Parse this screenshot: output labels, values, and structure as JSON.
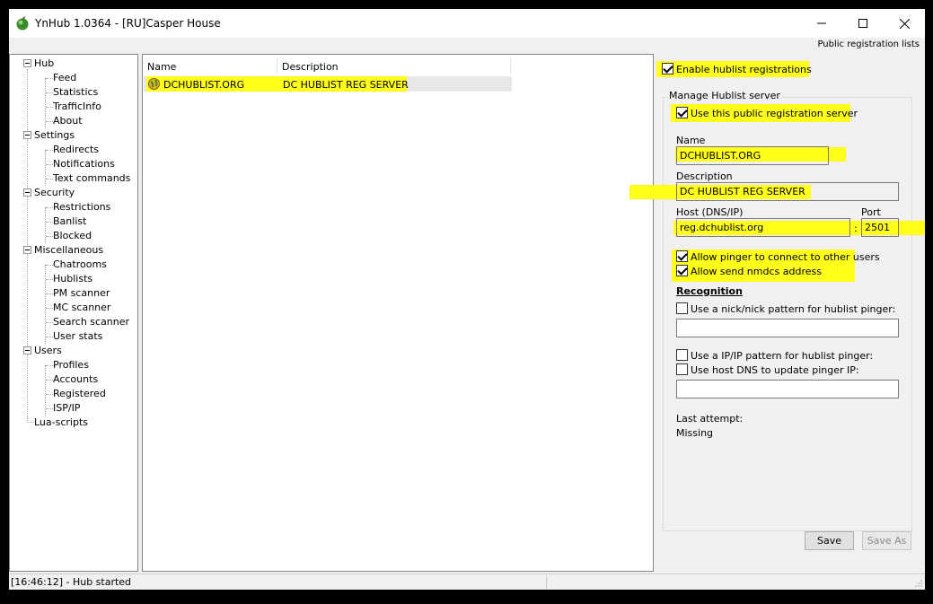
{
  "window": {
    "title": "YnHub 1.0364 - [RU]Casper House",
    "page_label": "Public registration lists"
  },
  "tree": {
    "hub": "Hub",
    "feed": "Feed",
    "statistics": "Statistics",
    "trafficinfo": "TrafficInfo",
    "about": "About",
    "settings": "Settings",
    "redirects": "Redirects",
    "notifications": "Notifications",
    "text_commands": "Text commands",
    "security": "Security",
    "restrictions": "Restrictions",
    "banlist": "Banlist",
    "blocked": "Blocked",
    "misc": "Miscellaneous",
    "chatrooms": "Chatrooms",
    "hublists": "Hublists",
    "pm_scanner": "PM scanner",
    "mc_scanner": "MC scanner",
    "search_scanner": "Search scanner",
    "user_stats": "User stats",
    "users": "Users",
    "profiles": "Profiles",
    "accounts": "Accounts",
    "registered": "Registered",
    "isp_ip": "ISP/IP",
    "lua": "Lua-scripts"
  },
  "list": {
    "col_name": "Name",
    "col_desc": "Description",
    "rows": [
      {
        "name": "DCHUBLIST.ORG",
        "desc": "DC HUBLIST REG SERVER"
      }
    ]
  },
  "panel": {
    "enable": "Enable hublist registrations",
    "group": "Manage Hublist server",
    "use_server": "Use this public registration server",
    "name_label": "Name",
    "name_value": "DCHUBLIST.ORG",
    "desc_label": "Description",
    "desc_value": "DC HUBLIST REG SERVER",
    "host_label": "Host (DNS/IP)",
    "host_value": "reg.dchublist.org",
    "colon": ":",
    "port_label": "Port",
    "port_value": "2501",
    "allow_pinger": "Allow pinger to connect to other users",
    "allow_nmdcs": "Allow send nmdcs address",
    "recognition": "Recognition",
    "nick_pattern": "Use a nick/nick pattern for hublist pinger:",
    "nick_value": "",
    "ip_pattern": "Use a IP/IP pattern for hublist pinger:",
    "host_dns": "Use host DNS to update pinger IP:",
    "ip_value": "",
    "last_attempt": "Last attempt:",
    "last_value": "Missing",
    "save": "Save",
    "save_as": "Save As"
  },
  "status": {
    "text": "[16:46:12] - Hub started"
  },
  "colors": {
    "highlight": "#ffff1a",
    "background": "#f0f0f0"
  }
}
